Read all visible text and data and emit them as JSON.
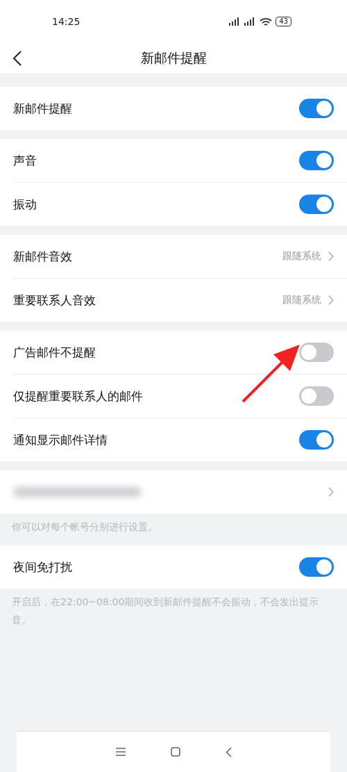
{
  "status_bar": {
    "time": "14:25",
    "battery": "43"
  },
  "header": {
    "title": "新邮件提醒"
  },
  "sections": [
    {
      "rows": [
        {
          "kind": "toggle",
          "label": "新邮件提醒",
          "on": true
        }
      ]
    },
    {
      "rows": [
        {
          "kind": "toggle",
          "label": "声音",
          "on": true
        },
        {
          "kind": "toggle",
          "label": "振动",
          "on": true
        }
      ]
    },
    {
      "rows": [
        {
          "kind": "link",
          "label": "新邮件音效",
          "value": "跟随系统"
        },
        {
          "kind": "link",
          "label": "重要联系人音效",
          "value": "跟随系统"
        }
      ]
    },
    {
      "rows": [
        {
          "kind": "toggle",
          "label": "广告邮件不提醒",
          "on": false,
          "annotated": true
        },
        {
          "kind": "toggle",
          "label": "仅提醒重要联系人的邮件",
          "on": false
        },
        {
          "kind": "toggle",
          "label": "通知显示邮件详情",
          "on": true
        }
      ]
    },
    {
      "rows": [
        {
          "kind": "account"
        }
      ],
      "note": "你可以对每个帐号分别进行设置。"
    },
    {
      "rows": [
        {
          "kind": "toggle",
          "label": "夜间免打扰",
          "on": true
        }
      ],
      "note": "开启后，在22:00~08:00期间收到新邮件提醒不会振动，不会发出提示音。"
    }
  ]
}
